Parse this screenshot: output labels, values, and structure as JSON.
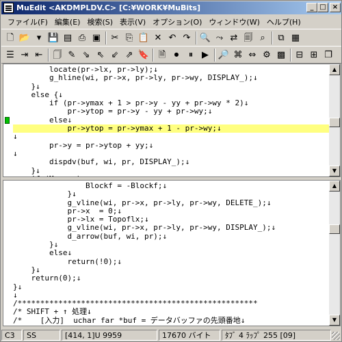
{
  "window": {
    "title": "MuEdit <AKDMPLDV.C> [C:¥WORK¥MuBits]",
    "min_label": "_",
    "max_label": "□",
    "close_label": "×"
  },
  "menu": [
    "ファイル(F)",
    "編集(E)",
    "検索(S)",
    "表示(V)",
    "オプション(O)",
    "ウィンドウ(W)",
    "ヘルプ(H)"
  ],
  "toolbar1": [
    {
      "name": "new-file-icon",
      "glyph": "🗋"
    },
    {
      "name": "open-folder-icon",
      "glyph": "📂"
    },
    {
      "name": "open-dropdown-icon",
      "glyph": "▾"
    },
    {
      "name": "save-icon",
      "glyph": "💾"
    },
    {
      "name": "save-all-icon",
      "glyph": "▤"
    },
    {
      "name": "print-icon",
      "glyph": "⎙"
    },
    {
      "name": "window-icon",
      "glyph": "▣"
    },
    {
      "name": "cut-icon",
      "glyph": "✂"
    },
    {
      "name": "copy-icon",
      "glyph": "⎘"
    },
    {
      "name": "paste-icon",
      "glyph": "📋"
    },
    {
      "name": "delete-icon",
      "glyph": "✕"
    },
    {
      "name": "undo-icon",
      "glyph": "↶"
    },
    {
      "name": "redo-icon",
      "glyph": "↷"
    },
    {
      "name": "find-icon",
      "glyph": "🔍"
    },
    {
      "name": "find-next-icon",
      "glyph": "⤳"
    },
    {
      "name": "replace-icon",
      "glyph": "⇄"
    },
    {
      "name": "find-files-icon",
      "glyph": "🗐"
    },
    {
      "name": "grep-icon",
      "glyph": "⌕"
    },
    {
      "name": "windows-icon",
      "glyph": "⧉"
    },
    {
      "name": "tile-icon",
      "glyph": "▦"
    }
  ],
  "toolbar2": [
    {
      "name": "list-icon",
      "glyph": "☰"
    },
    {
      "name": "indent-icon",
      "glyph": "⇥"
    },
    {
      "name": "outdent-icon",
      "glyph": "⇤"
    },
    {
      "name": "copy-doc-icon",
      "glyph": "🗍"
    },
    {
      "name": "marker-icon",
      "glyph": "✎"
    },
    {
      "name": "jump-icon",
      "glyph": "⇘"
    },
    {
      "name": "mark-prev-icon",
      "glyph": "⇖"
    },
    {
      "name": "mark-next-icon",
      "glyph": "⇙"
    },
    {
      "name": "mark-list-icon",
      "glyph": "⇗"
    },
    {
      "name": "bookmark-icon",
      "glyph": "🔖"
    },
    {
      "name": "doc-icon",
      "glyph": "🗎"
    },
    {
      "name": "record-icon",
      "glyph": "⏺"
    },
    {
      "name": "pause-macro-icon",
      "glyph": "⏸"
    },
    {
      "name": "play-macro-icon",
      "glyph": "▶"
    },
    {
      "name": "search-doc-icon",
      "glyph": "🔎"
    },
    {
      "name": "tag-jump-icon",
      "glyph": "⌘"
    },
    {
      "name": "compare-icon",
      "glyph": "⇔"
    },
    {
      "name": "compile-icon",
      "glyph": "⚙"
    },
    {
      "name": "color-icon",
      "glyph": "▩"
    },
    {
      "name": "horizontal-split-icon",
      "glyph": "⊟"
    },
    {
      "name": "vertical-split-icon",
      "glyph": "⊞"
    },
    {
      "name": "cascade-icon",
      "glyph": "❐"
    }
  ],
  "pane1": {
    "lines": [
      "        locate(pr->lx, pr->ly);↓",
      "        g_hline(wi, pr->x, pr->ly, pr->wy, DISPLAY_);↓",
      "    }↓",
      "    else {↓",
      "        if (pr->ymax + 1 > pr->y - yy + pr->wy * 2)↓",
      "            pr->ytop = pr->y - yy + pr->wy;↓",
      "        else↓",
      "            pr->ytop = pr->ymax + 1 - pr->wy;↓",
      "↓",
      "        pr->y = pr->ytop + yy;↓",
      "↓",
      "        dispdv(buf, wi, pr, DISPLAY_);↓",
      "    }↓",
      "    if (Memory)↓"
    ],
    "highlight_index": 7,
    "green_mark_index": 6
  },
  "pane2": {
    "lines": [
      "                Blockf = -Blockf;↓",
      "            }↓",
      "            g_vline(wi, pr->x, pr->ly, pr->wy, DELETE_);↓",
      "            pr->x  = 0;↓",
      "            pr->lx = Topoflx;↓",
      "            g_vline(wi, pr->x, pr->ly, pr->wy, DISPLAY_);↓",
      "            d_arrow(buf, wi, pr);↓",
      "        }↓",
      "        else↓",
      "            return(!0);↓",
      "    }↓",
      "    return(0);↓",
      "}↓",
      "↓",
      "/*****************************************************",
      "/* SHIFT + ↑ 処理↓",
      "/*    [入力]  uchar far *buf = データバッファの先頭番地↓",
      "/*"
    ]
  },
  "status": {
    "mode": "C3",
    "ss": "SS",
    "position": "[414, 1]U 9959",
    "size": "17670 バイト",
    "tab": "ﾀﾌﾞ 4  ﾗｯﾌﾟ 255  [09]"
  }
}
